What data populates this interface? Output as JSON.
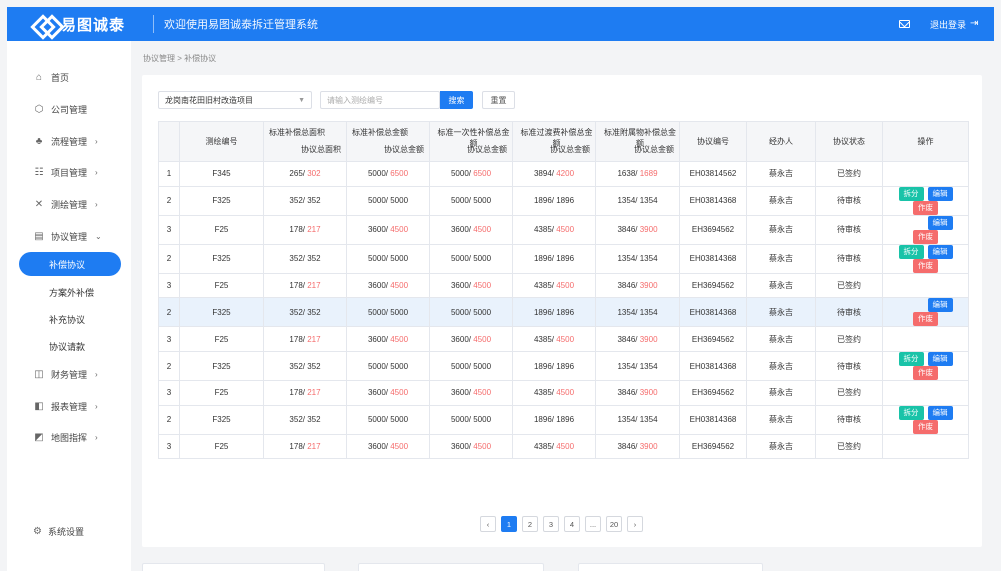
{
  "header": {
    "logo_text": "易图诚泰",
    "welcome": "欢迎使用易图诚泰拆迁管理系统",
    "logout": "退出登录"
  },
  "sidebar": {
    "items": [
      {
        "label": "首页",
        "icon": "home-icon",
        "glyph": "⌂"
      },
      {
        "label": "公司管理",
        "icon": "building-icon",
        "glyph": "⬡"
      },
      {
        "label": "流程管理",
        "icon": "flow-icon",
        "glyph": "♣",
        "chevron": "›"
      },
      {
        "label": "项目管理",
        "icon": "project-icon",
        "glyph": "☷",
        "chevron": "›"
      },
      {
        "label": "测绘管理",
        "icon": "tools-icon",
        "glyph": "✕",
        "chevron": "›"
      },
      {
        "label": "协议管理",
        "icon": "file-icon",
        "glyph": "▤",
        "chevron": "⌄"
      },
      {
        "label": "财务管理",
        "icon": "finance-icon",
        "glyph": "◫",
        "chevron": "›"
      },
      {
        "label": "报表管理",
        "icon": "chart-icon",
        "glyph": "◧",
        "chevron": "›"
      },
      {
        "label": "地图指挥",
        "icon": "map-icon",
        "glyph": "◩",
        "chevron": "›"
      }
    ],
    "subitems": [
      "补偿协议",
      "方案外补偿",
      "补充协议",
      "协议请款"
    ],
    "settings": {
      "label": "系统设置",
      "glyph": "⚙"
    }
  },
  "breadcrumb": "协议管理 > 补偿协议",
  "filters": {
    "project": "龙岗南花田旧村改造项目",
    "search_placeholder": "请输入测绘编号",
    "search_label": "搜索",
    "reset_label": "重置"
  },
  "table": {
    "headers": {
      "survey": "测绘编号",
      "std_area": "标准补偿总面积",
      "agr_area": "协议总面积",
      "std_amount": "标准补偿总金额",
      "agr_amount": "协议总金额",
      "std_once": "标准一次性补偿总金额",
      "std_transit": "标准过渡费补偿总金额",
      "std_attach": "标准附属物补偿总金额",
      "agr_no": "协议编号",
      "handler": "经办人",
      "status": "协议状态",
      "ops": "操作"
    },
    "op_labels": {
      "split": "拆分",
      "edit": "编辑",
      "void": "作废"
    },
    "rows": [
      {
        "idx": "1",
        "survey": "F345",
        "area_a": "265/ ",
        "area_b": "302",
        "amt_a": "5000/ ",
        "amt_b": "6500",
        "once_a": "5000/ ",
        "once_b": "6500",
        "trans_a": "3894/ ",
        "trans_b": "4200",
        "att_a": "1638/ ",
        "att_b": "1689",
        "agr_no": "EH03814562",
        "handler": "蔡永吉",
        "status": "已签约",
        "pending": false,
        "ops": [],
        "hl": false
      },
      {
        "idx": "2",
        "survey": "F325",
        "area_a": "352/ ",
        "area_b": "352",
        "amt_a": "5000/ ",
        "amt_b": "5000",
        "once_a": "5000/ ",
        "once_b": "5000",
        "trans_a": "1896/ ",
        "trans_b": "1896",
        "att_a": "1354/ ",
        "att_b": "1354",
        "agr_no": "EH03814368",
        "handler": "蔡永吉",
        "status": "待审核",
        "pending": true,
        "ops": [
          "split",
          "edit",
          "void"
        ],
        "hl": false
      },
      {
        "idx": "3",
        "survey": "F25",
        "area_a": "178/ ",
        "area_b": "217",
        "amt_a": "3600/ ",
        "amt_b": "4500",
        "once_a": "3600/ ",
        "once_b": "4500",
        "trans_a": "4385/ ",
        "trans_b": "4500",
        "att_a": "3846/ ",
        "att_b": "3900",
        "agr_no": "EH3694562",
        "handler": "蔡永吉",
        "status": "待审核",
        "pending": true,
        "ops": [
          "edit",
          "void"
        ],
        "hl": false
      },
      {
        "idx": "2",
        "survey": "F325",
        "area_a": "352/ ",
        "area_b": "352",
        "amt_a": "5000/ ",
        "amt_b": "5000",
        "once_a": "5000/ ",
        "once_b": "5000",
        "trans_a": "1896/ ",
        "trans_b": "1896",
        "att_a": "1354/ ",
        "att_b": "1354",
        "agr_no": "EH03814368",
        "handler": "蔡永吉",
        "status": "待审核",
        "pending": true,
        "ops": [
          "split",
          "edit",
          "void"
        ],
        "hl": false
      },
      {
        "idx": "3",
        "survey": "F25",
        "area_a": "178/ ",
        "area_b": "217",
        "amt_a": "3600/ ",
        "amt_b": "4500",
        "once_a": "3600/ ",
        "once_b": "4500",
        "trans_a": "4385/ ",
        "trans_b": "4500",
        "att_a": "3846/ ",
        "att_b": "3900",
        "agr_no": "EH3694562",
        "handler": "蔡永吉",
        "status": "已签约",
        "pending": false,
        "ops": [],
        "hl": false
      },
      {
        "idx": "2",
        "survey": "F325",
        "area_a": "352/ ",
        "area_b": "352",
        "amt_a": "5000/ ",
        "amt_b": "5000",
        "once_a": "5000/ ",
        "once_b": "5000",
        "trans_a": "1896/ ",
        "trans_b": "1896",
        "att_a": "1354/ ",
        "att_b": "1354",
        "agr_no": "EH03814368",
        "handler": "蔡永吉",
        "status": "待审核",
        "pending": true,
        "ops": [
          "edit",
          "void"
        ],
        "hl": true
      },
      {
        "idx": "3",
        "survey": "F25",
        "area_a": "178/ ",
        "area_b": "217",
        "amt_a": "3600/ ",
        "amt_b": "4500",
        "once_a": "3600/ ",
        "once_b": "4500",
        "trans_a": "4385/ ",
        "trans_b": "4500",
        "att_a": "3846/ ",
        "att_b": "3900",
        "agr_no": "EH3694562",
        "handler": "蔡永吉",
        "status": "已签约",
        "pending": false,
        "ops": [],
        "hl": false
      },
      {
        "idx": "2",
        "survey": "F325",
        "area_a": "352/ ",
        "area_b": "352",
        "amt_a": "5000/ ",
        "amt_b": "5000",
        "once_a": "5000/ ",
        "once_b": "5000",
        "trans_a": "1896/ ",
        "trans_b": "1896",
        "att_a": "1354/ ",
        "att_b": "1354",
        "agr_no": "EH03814368",
        "handler": "蔡永吉",
        "status": "待审核",
        "pending": true,
        "ops": [
          "split",
          "edit",
          "void"
        ],
        "hl": false
      },
      {
        "idx": "3",
        "survey": "F25",
        "area_a": "178/ ",
        "area_b": "217",
        "amt_a": "3600/ ",
        "amt_b": "4500",
        "once_a": "3600/ ",
        "once_b": "4500",
        "trans_a": "4385/ ",
        "trans_b": "4500",
        "att_a": "3846/ ",
        "att_b": "3900",
        "agr_no": "EH3694562",
        "handler": "蔡永吉",
        "status": "已签约",
        "pending": false,
        "ops": [],
        "hl": false
      },
      {
        "idx": "2",
        "survey": "F325",
        "area_a": "352/ ",
        "area_b": "352",
        "amt_a": "5000/ ",
        "amt_b": "5000",
        "once_a": "5000/ ",
        "once_b": "5000",
        "trans_a": "1896/ ",
        "trans_b": "1896",
        "att_a": "1354/ ",
        "att_b": "1354",
        "agr_no": "EH03814368",
        "handler": "蔡永吉",
        "status": "待审核",
        "pending": true,
        "ops": [
          "split",
          "edit",
          "void"
        ],
        "hl": false
      },
      {
        "idx": "3",
        "survey": "F25",
        "area_a": "178/ ",
        "area_b": "217",
        "amt_a": "3600/ ",
        "amt_b": "4500",
        "once_a": "3600/ ",
        "once_b": "4500",
        "trans_a": "4385/ ",
        "trans_b": "4500",
        "att_a": "3846/ ",
        "att_b": "3900",
        "agr_no": "EH3694562",
        "handler": "蔡永吉",
        "status": "已签约",
        "pending": false,
        "ops": [],
        "hl": false
      }
    ]
  },
  "pagination": {
    "prev": "‹",
    "pages": [
      "1",
      "2",
      "3",
      "4",
      "...",
      "20"
    ],
    "next": "›",
    "active": "1"
  },
  "colors": {
    "primary": "#1e7cf2",
    "danger": "#f56c6c",
    "success": "#19be6b",
    "teal": "#19c3a8"
  }
}
